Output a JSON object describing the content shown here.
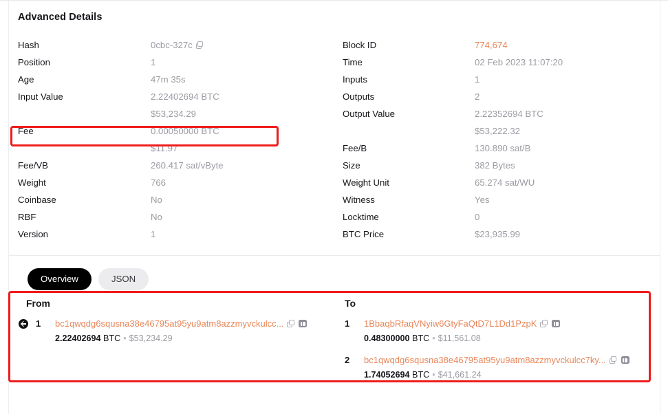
{
  "card": {
    "title": "Advanced Details"
  },
  "details": {
    "left": [
      {
        "label": "Hash",
        "value": "0cbc-327c",
        "copy": true
      },
      {
        "label": "Position",
        "value": "1"
      },
      {
        "label": "Age",
        "value": "47m 35s"
      },
      {
        "label": "Input Value",
        "value": "2.22402694 BTC",
        "sub": "$53,234.29"
      },
      {
        "label": "Fee",
        "value": "0.00050000 BTC",
        "sub": "$11.97",
        "highlighted": true
      },
      {
        "label": "Fee/VB",
        "value": "260.417 sat/vByte"
      },
      {
        "label": "Weight",
        "value": "766"
      },
      {
        "label": "Coinbase",
        "value": "No"
      },
      {
        "label": "RBF",
        "value": "No"
      },
      {
        "label": "Version",
        "value": "1"
      }
    ],
    "right": [
      {
        "label": "Block ID",
        "value": "774,674",
        "accent": true
      },
      {
        "label": "Time",
        "value": "02 Feb 2023 11:07:20"
      },
      {
        "label": "Inputs",
        "value": "1"
      },
      {
        "label": "Outputs",
        "value": "2"
      },
      {
        "label": "Output Value",
        "value": "2.22352694 BTC",
        "sub": "$53,222.32"
      },
      {
        "label": "Fee/B",
        "value": "130.890 sat/B"
      },
      {
        "label": "Size",
        "value": "382 Bytes"
      },
      {
        "label": "Weight Unit",
        "value": "65.274 sat/WU"
      },
      {
        "label": "Witness",
        "value": "Yes"
      },
      {
        "label": "Locktime",
        "value": "0"
      },
      {
        "label": "BTC Price",
        "value": "$23,935.99"
      }
    ]
  },
  "tabs": [
    {
      "label": "Overview",
      "active": true
    },
    {
      "label": "JSON",
      "active": false
    }
  ],
  "io": {
    "from": {
      "heading": "From",
      "rows": [
        {
          "index": "1",
          "address": "bc1qwqdg6squsna38e46795at95yu9atm8azzmyvckulcc...",
          "btc": "2.22402694",
          "unit": "BTC",
          "separator": "•",
          "fiat": "$53,234.29"
        }
      ]
    },
    "to": {
      "heading": "To",
      "rows": [
        {
          "index": "1",
          "address": "1BbaqbRfaqVNyiw6GtyFaQtD7L1Dd1PzpK",
          "btc": "0.48300000",
          "unit": "BTC",
          "separator": "•",
          "fiat": "$11,561.08"
        },
        {
          "index": "2",
          "address": "bc1qwqdg6squsna38e46795at95yu9atm8azzmyvckulcc7ky...",
          "btc": "1.74052694",
          "unit": "BTC",
          "separator": "•",
          "fiat": "$41,661.24"
        }
      ]
    }
  },
  "colors": {
    "accent": "#e8875a",
    "highlight": "#f01b1b",
    "text": "#15161a",
    "muted": "#9b9ba3"
  }
}
